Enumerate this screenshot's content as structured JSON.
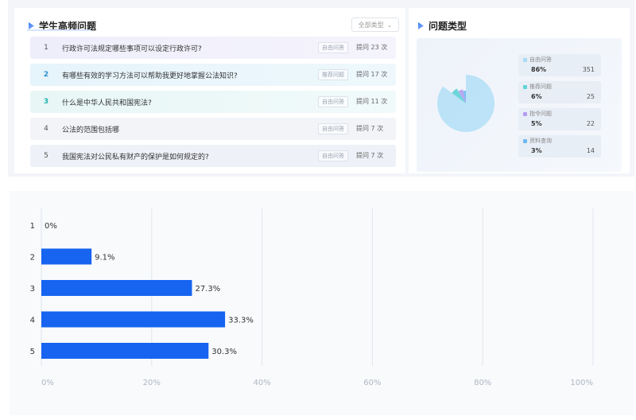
{
  "left_panel": {
    "title": "学生高频问题",
    "filter": {
      "selected": "全部类型"
    },
    "questions": [
      {
        "rank": "1",
        "text": "行政许可法规定哪些事项可以设定行政许可?",
        "tag": "自由问答",
        "count": "提问 23 次"
      },
      {
        "rank": "2",
        "text": "有哪些有效的学习方法可以帮助我更好地掌握公法知识?",
        "tag": "推荐问题",
        "count": "提问 17 次"
      },
      {
        "rank": "3",
        "text": "什么是中华人民共和国宪法?",
        "tag": "自由问答",
        "count": "提问 11 次"
      },
      {
        "rank": "4",
        "text": "公法的范围包括哪",
        "tag": "自由问答",
        "count": "提问 7 次"
      },
      {
        "rank": "5",
        "text": "我国宪法对公民私有财产的保护是如何规定的?",
        "tag": "自由问答",
        "count": "提问 7 次"
      }
    ]
  },
  "right_panel": {
    "title": "问题类型",
    "legend": [
      {
        "name": "自由问答",
        "percent": "86%",
        "count": "351",
        "color": "#a9dcf5"
      },
      {
        "name": "推荐问题",
        "percent": "6%",
        "count": "25",
        "color": "#5fd3d6"
      },
      {
        "name": "指令问题",
        "percent": "5%",
        "count": "22",
        "color": "#b39ef0"
      },
      {
        "name": "资料查询",
        "percent": "3%",
        "count": "14",
        "color": "#6db8f2"
      }
    ]
  },
  "chart_data": {
    "type": "bar",
    "orientation": "horizontal",
    "categories": [
      "1",
      "2",
      "3",
      "4",
      "5"
    ],
    "values": [
      0,
      9.1,
      27.3,
      33.3,
      30.3
    ],
    "value_labels": [
      "0%",
      "9.1%",
      "27.3%",
      "33.3%",
      "30.3%"
    ],
    "x_ticks": [
      "0%",
      "20%",
      "40%",
      "60%",
      "80%",
      "100%"
    ],
    "xlim": [
      0,
      100
    ],
    "bar_color": "#1664f0",
    "grid": true
  }
}
